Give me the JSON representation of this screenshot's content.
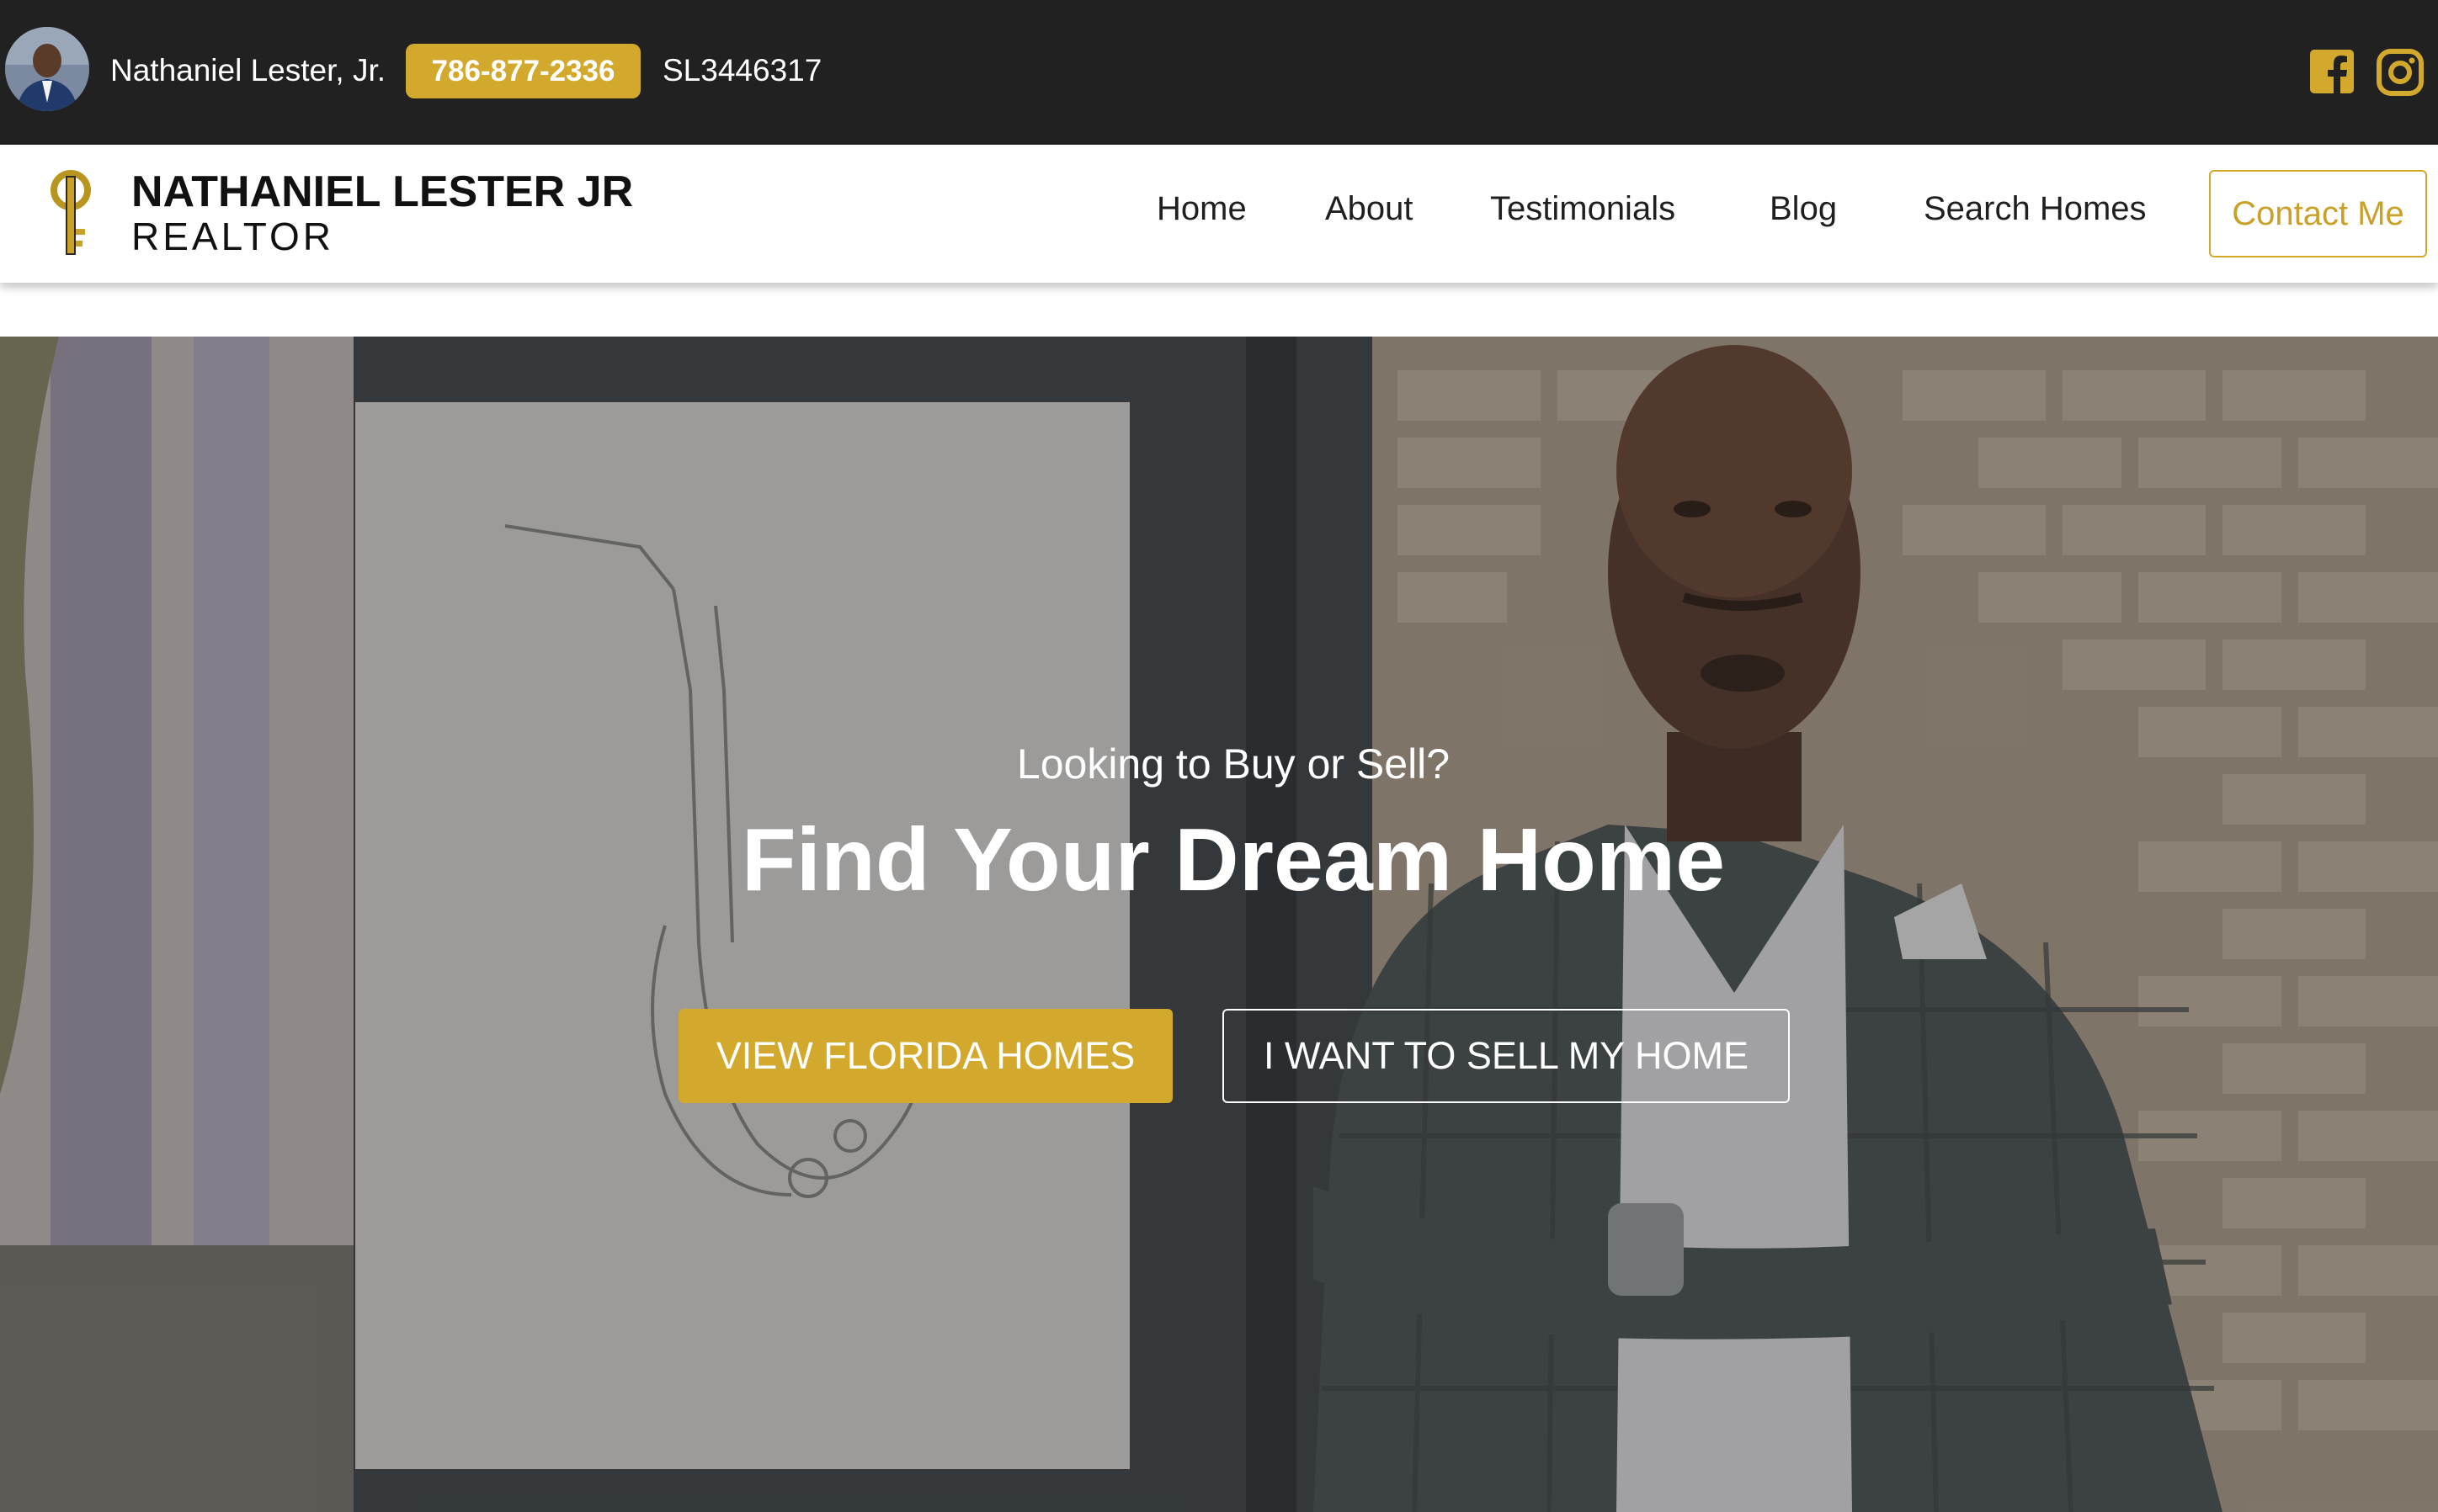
{
  "topbar": {
    "name": "Nathaniel Lester, Jr.",
    "phone": "786-877-2336",
    "license": "SL3446317",
    "icons": [
      "facebook-icon",
      "instagram-icon"
    ]
  },
  "logo": {
    "name": "NATHANIEL LESTER JR",
    "subtitle": "REALTOR"
  },
  "nav": {
    "items": [
      "Home",
      "About",
      "Testimonials",
      "Blog",
      "Search Homes"
    ],
    "contact_label": "Contact Me"
  },
  "hero": {
    "kicker": "Looking to Buy or Sell?",
    "title": "Find Your Dream Home",
    "primary_button": "VIEW FLORIDA HOMES",
    "secondary_button": "I WANT TO SELL MY HOME"
  },
  "colors": {
    "topbar_bg": "#212121",
    "accent_gold": "#d2a92d",
    "nav_text": "#1f1f1f"
  }
}
